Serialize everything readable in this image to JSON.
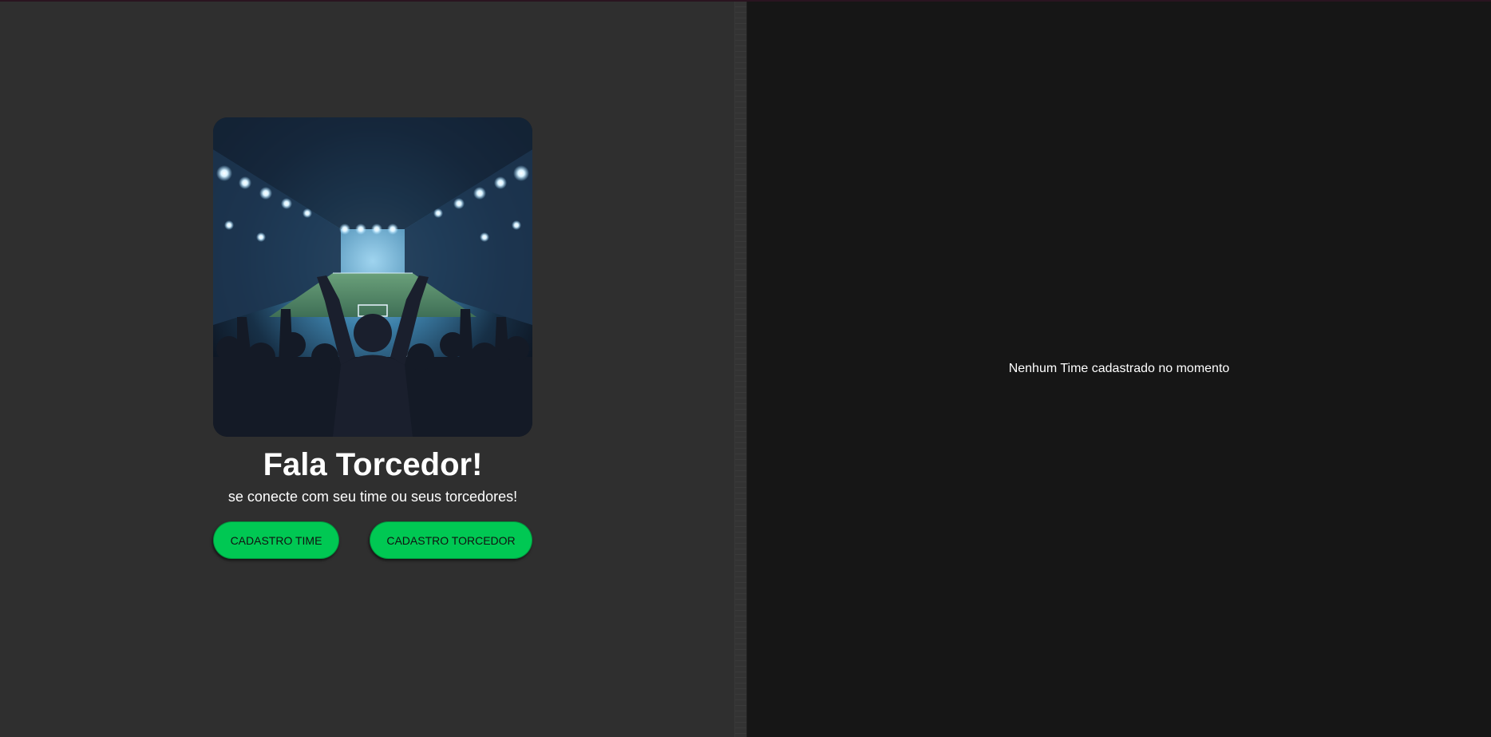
{
  "hero": {
    "image_alt": "stadium-fans-illustration",
    "title": "Fala Torcedor!",
    "subtitle": "se conecte com seu time ou seus torcedores!"
  },
  "actions": {
    "cadastro_time_label": "CADASTRO TIME",
    "cadastro_torcedor_label": "CADASTRO TORCEDOR"
  },
  "teams_panel": {
    "empty_message": "Nenhum Time cadastrado no momento"
  },
  "colors": {
    "left_background": "#2f2f2f",
    "right_background": "#161616",
    "button_green": "#00c853",
    "text": "#ffffff"
  }
}
